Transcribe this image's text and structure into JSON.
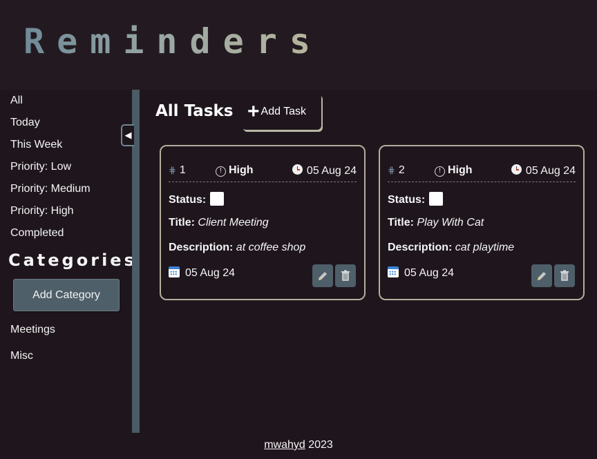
{
  "app": {
    "title": "Reminders"
  },
  "sidebar": {
    "filters": [
      "All",
      "Today",
      "This Week",
      "Priority: Low",
      "Priority: Medium",
      "Priority: High",
      "Completed"
    ],
    "categories_title": "Categories",
    "add_category_label": "Add Category",
    "categories": [
      "Meetings",
      "Misc"
    ],
    "collapse_glyph": "◀"
  },
  "main": {
    "title": "All Tasks",
    "add_task_label": "Add Task",
    "add_task_icon": "plus-icon"
  },
  "labels": {
    "status": "Status:",
    "title": "Title:",
    "description": "Description:"
  },
  "tasks": [
    {
      "id": "1",
      "priority": "High",
      "date": "05 Aug 24",
      "title": "Client Meeting",
      "description": "at coffee shop",
      "due": "05 Aug 24",
      "completed": false
    },
    {
      "id": "2",
      "priority": "High",
      "date": "05 Aug 24",
      "title": "Play With Cat",
      "description": "cat playtime",
      "due": "05 Aug 24",
      "completed": false
    }
  ],
  "footer": {
    "author": "mwahyd",
    "year": "2023"
  },
  "colors": {
    "background": "#1f161d",
    "accent": "#4e5f69",
    "card_border": "#b4b09c"
  }
}
